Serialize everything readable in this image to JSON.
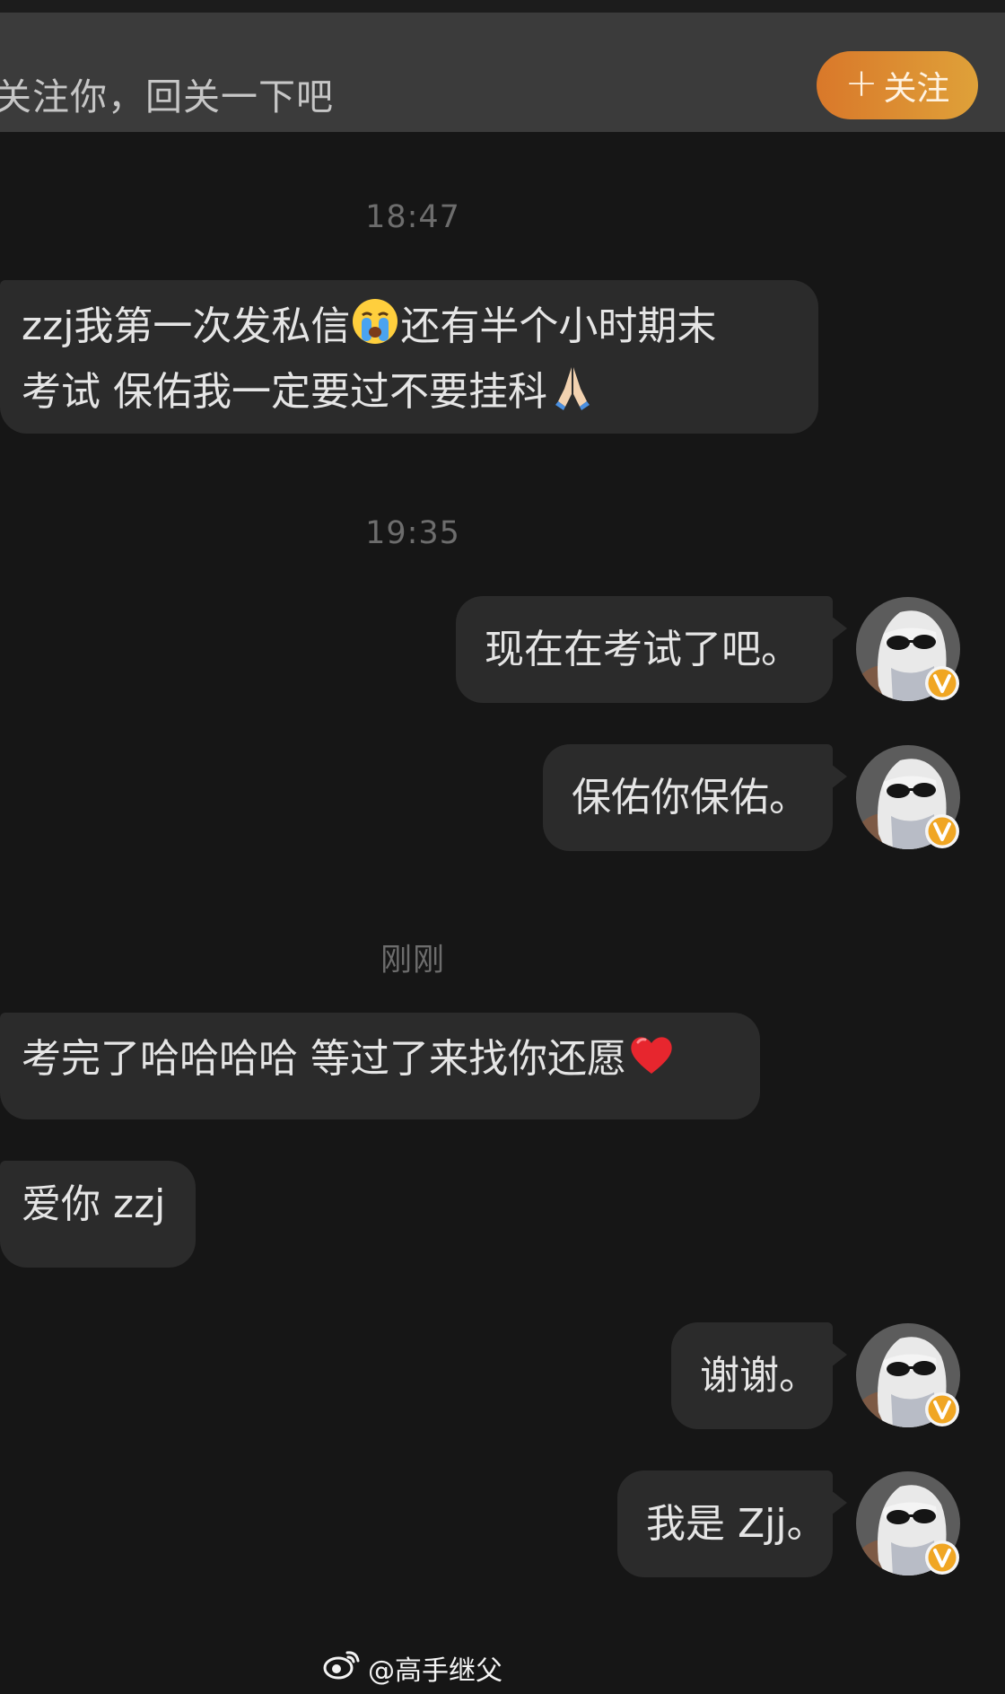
{
  "follow_bar": {
    "text": "关注你，回关一下吧",
    "button_label": "关注",
    "button_icon": "plus-icon",
    "button_colors": [
      "#d9782a",
      "#dfa139"
    ]
  },
  "conversation": {
    "times": [
      "18:47",
      "19:35",
      "刚刚"
    ],
    "received": [
      {
        "line1": "zzj我第一次发私信",
        "line1_after": "还有半个小时期末",
        "line2": "考试 保佑我一定要过不要挂科",
        "emoji1": "loudly-crying-face",
        "emoji2": "folded-hands"
      },
      {
        "text": "考完了哈哈哈哈 等过了来找你还愿",
        "emoji": "red-heart"
      },
      {
        "text": "爱你 zzj"
      }
    ],
    "sent": [
      {
        "text": "现在在考试了吧。"
      },
      {
        "text": "保佑你保佑。"
      },
      {
        "text": "谢谢。"
      },
      {
        "text": "我是 Zjj。"
      }
    ],
    "avatar_badge": "verified-v-badge",
    "avatar_badge_color": "#f0a623"
  },
  "watermark": {
    "text": "@高手继父",
    "icon": "weibo-logo-icon"
  }
}
